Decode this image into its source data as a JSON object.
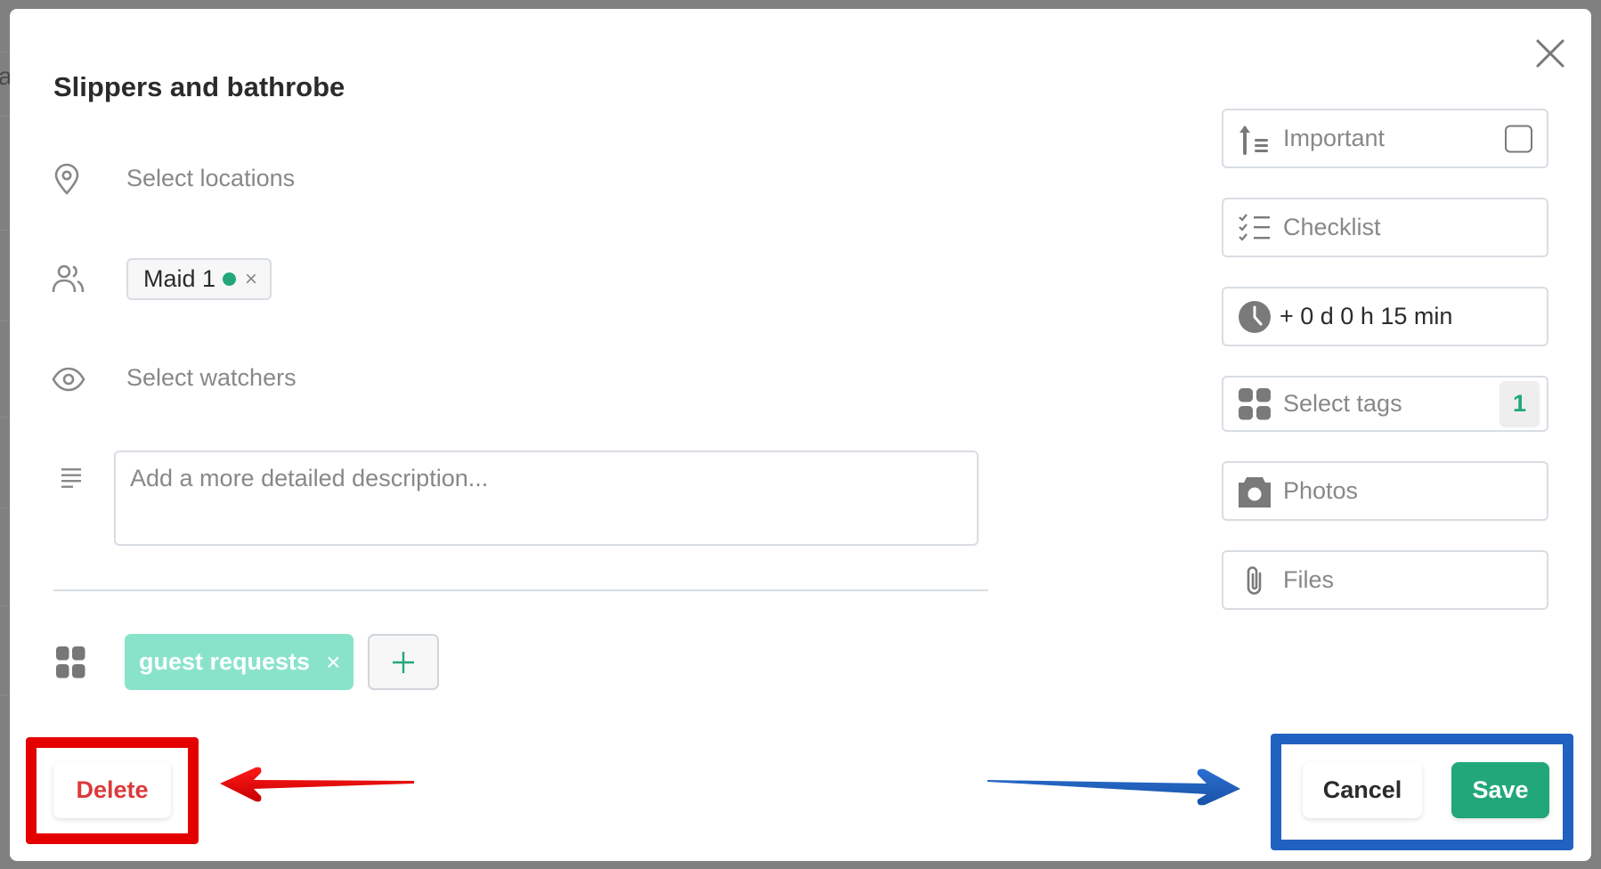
{
  "background": {
    "partial_text": "a"
  },
  "modal": {
    "title": "Slippers and bathrobe",
    "fields": {
      "locations_placeholder": "Select locations",
      "watchers_placeholder": "Select watchers",
      "description_placeholder": "Add a more detailed description...",
      "description_value": ""
    },
    "assignees": [
      {
        "name": "Maid 1",
        "status": "online",
        "status_color": "#22a77b",
        "remove_label": "×"
      }
    ],
    "tags": [
      {
        "label": "guest requests",
        "color": "#89e3cb",
        "remove_label": "×"
      }
    ],
    "add_tag_label": "+",
    "side_actions": {
      "important": {
        "label": "Important",
        "checked": false
      },
      "checklist": {
        "label": "Checklist"
      },
      "duration": {
        "label": "+ 0 d 0 h 15 min"
      },
      "tags": {
        "label": "Select tags",
        "count": "1"
      },
      "photos": {
        "label": "Photos"
      },
      "files": {
        "label": "Files"
      }
    },
    "footer": {
      "delete_label": "Delete",
      "cancel_label": "Cancel",
      "save_label": "Save"
    }
  },
  "colors": {
    "accent": "#22a77b",
    "danger": "#db3a3a",
    "annotation_red": "#e50000",
    "annotation_blue": "#2161c0"
  }
}
